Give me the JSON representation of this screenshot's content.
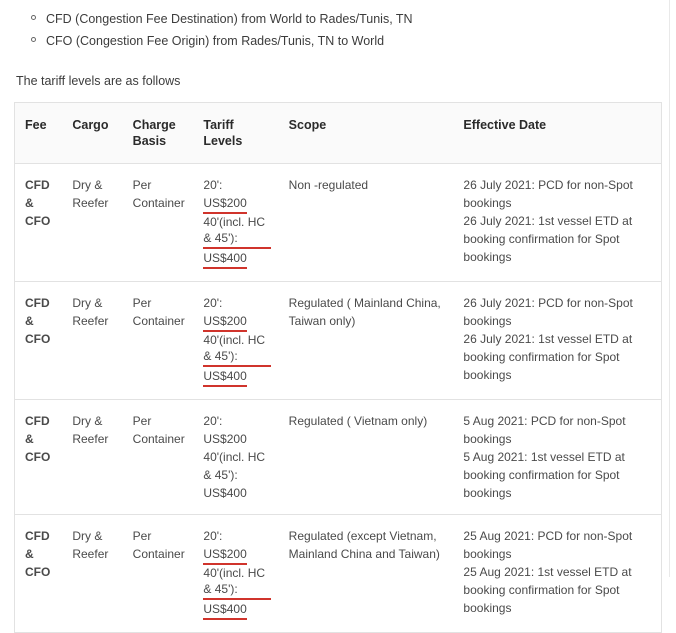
{
  "bullets": [
    "CFD (Congestion Fee Destination) from World to Rades/Tunis, TN",
    "CFO (Congestion Fee Origin) from Rades/Tunis, TN to World"
  ],
  "intro": "The tariff levels are as follows",
  "table": {
    "headers": [
      "Fee",
      "Cargo",
      "Charge Basis",
      "Tariff Levels",
      "Scope",
      "Effective Date"
    ],
    "rows": [
      {
        "fee": "CFD & CFO",
        "cargo": "Dry & Reefer",
        "basis": "Per Container",
        "tariff": [
          "20':",
          "US$200",
          "40'(incl. HC & 45'):",
          "US$400"
        ],
        "scope": "Non -regulated",
        "dates": [
          "26 July 2021: PCD for non-Spot bookings",
          "26 July 2021: 1st vessel ETD at booking confirmation for Spot bookings"
        ]
      },
      {
        "fee": "CFD & CFO",
        "cargo": "Dry & Reefer",
        "basis": "Per Container",
        "tariff": [
          "20':",
          "US$200",
          "40'(incl. HC & 45'):",
          "US$400"
        ],
        "scope": "Regulated ( Mainland China, Taiwan only)",
        "dates": [
          "26 July 2021: PCD for non-Spot bookings",
          "26 July 2021: 1st vessel ETD at booking confirmation for Spot bookings"
        ]
      },
      {
        "fee": "CFD & CFO",
        "cargo": "Dry & Reefer",
        "basis": "Per Container",
        "tariff": [
          "20':",
          "US$200",
          "40'(incl. HC & 45'):",
          "US$400"
        ],
        "scope": "Regulated ( Vietnam only)",
        "dates": [
          "5 Aug 2021: PCD for non-Spot bookings",
          "5 Aug 2021: 1st vessel ETD at booking confirmation for Spot bookings"
        ]
      },
      {
        "fee": "CFD & CFO",
        "cargo": "Dry & Reefer",
        "basis": "Per Container",
        "tariff": [
          "20':",
          "US$200",
          "40'(incl. HC & 45'):",
          "US$400"
        ],
        "scope": "Regulated (except Vietnam, Mainland China and Taiwan)",
        "dates": [
          "25 Aug 2021: PCD for non-Spot bookings",
          "25 Aug 2021: 1st vessel ETD at booking confirmation for Spot bookings"
        ]
      }
    ]
  },
  "colors": {
    "underline": "#d0342c",
    "header_bg": "#fafafa",
    "border": "#e2e2e2"
  }
}
